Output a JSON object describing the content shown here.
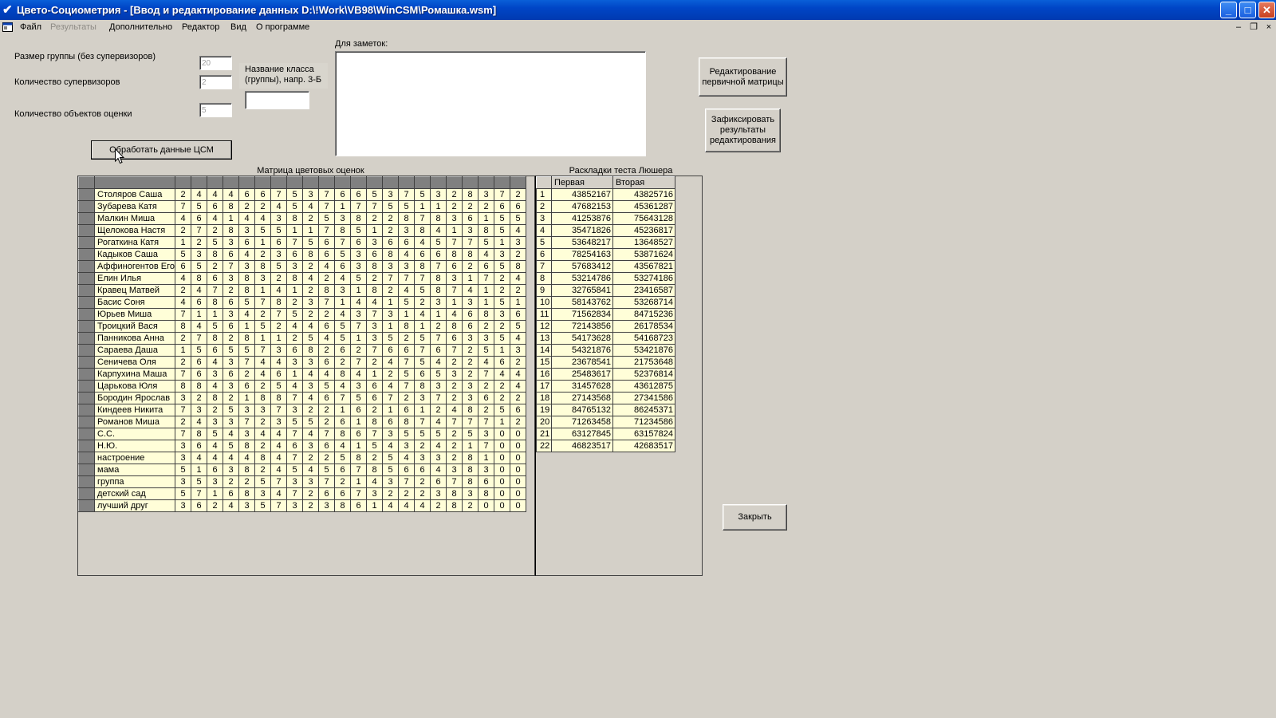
{
  "window": {
    "title": "Цвето-Социометрия - [Ввод  и редактирование данных D:\\!Work\\VB98\\WinCSM\\Ромашка.wsm]",
    "minimize": "_",
    "maximize": "□",
    "close": "✕"
  },
  "menu": {
    "items": [
      "Файл",
      "Результаты",
      "Дополнительно",
      "Редактор",
      "Вид",
      "О программе"
    ],
    "disabled_index": 1,
    "mdi_controls": [
      "–",
      "❐",
      "×"
    ]
  },
  "form": {
    "group_size_label": "Размер группы (без супервизоров)",
    "group_size_value": "20",
    "supervisors_label": "Количество супервизоров",
    "supervisors_value": "2",
    "objects_label": "Количество объектов оценки",
    "objects_value": "5",
    "class_name_label": "Название класса (группы), напр. 3-Б",
    "class_name_value": "",
    "notes_label": "Для заметок:",
    "notes_value": "",
    "process_button": "Обработать данные ЦСМ",
    "edit_matrix_button": "Редактирование первичной матрицы",
    "fix_results_button": "Зафиксировать результаты редактирования",
    "close_button": "Закрыть"
  },
  "matrix": {
    "caption": "Матрица цветовых оценок",
    "rows": [
      {
        "name": "Столяров Саша",
        "values": [
          2,
          4,
          4,
          4,
          6,
          6,
          7,
          5,
          3,
          7,
          6,
          6,
          5,
          3,
          7,
          5,
          3,
          2,
          8,
          3,
          7,
          2
        ]
      },
      {
        "name": "Зубарева Катя",
        "values": [
          7,
          5,
          6,
          8,
          2,
          2,
          4,
          5,
          4,
          7,
          1,
          7,
          7,
          5,
          5,
          1,
          1,
          2,
          2,
          2,
          6,
          6
        ]
      },
      {
        "name": "Малкин Миша",
        "values": [
          4,
          6,
          4,
          1,
          4,
          4,
          3,
          8,
          2,
          5,
          3,
          8,
          2,
          2,
          8,
          7,
          8,
          3,
          6,
          1,
          5,
          5
        ]
      },
      {
        "name": "Щелокова Настя",
        "values": [
          2,
          7,
          2,
          8,
          3,
          5,
          5,
          1,
          1,
          7,
          8,
          5,
          1,
          2,
          3,
          8,
          4,
          1,
          3,
          8,
          5,
          4
        ]
      },
      {
        "name": "Рогаткина Катя",
        "values": [
          1,
          2,
          5,
          3,
          6,
          1,
          6,
          7,
          5,
          6,
          7,
          6,
          3,
          6,
          6,
          4,
          5,
          7,
          7,
          5,
          1,
          3
        ]
      },
      {
        "name": "Кадыков Саша",
        "values": [
          5,
          3,
          8,
          6,
          4,
          2,
          3,
          6,
          8,
          6,
          5,
          3,
          6,
          8,
          4,
          6,
          6,
          8,
          8,
          4,
          3,
          2
        ]
      },
      {
        "name": "Аффиногентов Его",
        "values": [
          6,
          5,
          2,
          7,
          3,
          8,
          5,
          3,
          2,
          4,
          6,
          3,
          8,
          3,
          3,
          8,
          7,
          6,
          2,
          6,
          5,
          8
        ]
      },
      {
        "name": "Елин Илья",
        "values": [
          4,
          8,
          6,
          3,
          8,
          3,
          2,
          8,
          4,
          2,
          4,
          5,
          2,
          7,
          7,
          7,
          8,
          3,
          1,
          7,
          2,
          4
        ]
      },
      {
        "name": "Кравец Матвей",
        "values": [
          2,
          4,
          7,
          2,
          8,
          1,
          4,
          1,
          2,
          8,
          3,
          1,
          8,
          2,
          4,
          5,
          8,
          7,
          4,
          1,
          2,
          2
        ]
      },
      {
        "name": "Басис Соня",
        "values": [
          4,
          6,
          8,
          6,
          5,
          7,
          8,
          2,
          3,
          7,
          1,
          4,
          4,
          1,
          5,
          2,
          3,
          1,
          3,
          1,
          5,
          1
        ]
      },
      {
        "name": "Юрьев Миша",
        "values": [
          7,
          1,
          1,
          3,
          4,
          2,
          7,
          5,
          2,
          2,
          4,
          3,
          7,
          3,
          1,
          4,
          1,
          4,
          6,
          8,
          3,
          6
        ]
      },
      {
        "name": "Троицкий Вася",
        "values": [
          8,
          4,
          5,
          6,
          1,
          5,
          2,
          4,
          4,
          6,
          5,
          7,
          3,
          1,
          8,
          1,
          2,
          8,
          6,
          2,
          2,
          5
        ]
      },
      {
        "name": "Панникова Анна",
        "values": [
          2,
          7,
          8,
          2,
          8,
          1,
          1,
          2,
          5,
          4,
          5,
          1,
          3,
          5,
          2,
          5,
          7,
          6,
          3,
          3,
          5,
          4
        ]
      },
      {
        "name": "Сараева Даша",
        "values": [
          1,
          5,
          6,
          5,
          5,
          7,
          3,
          6,
          8,
          2,
          6,
          2,
          7,
          6,
          6,
          7,
          6,
          7,
          2,
          5,
          1,
          3
        ]
      },
      {
        "name": "Сеничева Оля",
        "values": [
          2,
          6,
          4,
          3,
          7,
          4,
          4,
          3,
          3,
          6,
          2,
          7,
          2,
          4,
          7,
          5,
          4,
          2,
          2,
          4,
          6,
          2
        ]
      },
      {
        "name": "Карпухина Маша",
        "values": [
          7,
          6,
          3,
          6,
          2,
          4,
          6,
          1,
          4,
          4,
          8,
          4,
          1,
          2,
          5,
          6,
          5,
          3,
          2,
          7,
          4,
          4
        ]
      },
      {
        "name": "Царькова Юля",
        "values": [
          8,
          8,
          4,
          3,
          6,
          2,
          5,
          4,
          3,
          5,
          4,
          3,
          6,
          4,
          7,
          8,
          3,
          2,
          3,
          2,
          2,
          4
        ]
      },
      {
        "name": "Бородин Ярослав",
        "values": [
          3,
          2,
          8,
          2,
          1,
          8,
          8,
          7,
          4,
          6,
          7,
          5,
          6,
          7,
          2,
          3,
          7,
          2,
          3,
          6,
          2,
          2
        ]
      },
      {
        "name": "Киндеев Никита",
        "values": [
          7,
          3,
          2,
          5,
          3,
          3,
          7,
          3,
          2,
          2,
          1,
          6,
          2,
          1,
          6,
          1,
          2,
          4,
          8,
          2,
          5,
          6
        ]
      },
      {
        "name": "Романов Миша",
        "values": [
          2,
          4,
          3,
          3,
          7,
          2,
          3,
          5,
          5,
          2,
          6,
          1,
          8,
          6,
          8,
          7,
          4,
          7,
          7,
          7,
          1,
          2
        ]
      },
      {
        "name": "С.С.",
        "values": [
          7,
          8,
          5,
          4,
          3,
          4,
          4,
          7,
          4,
          7,
          8,
          6,
          7,
          3,
          5,
          5,
          5,
          2,
          5,
          3,
          0,
          0
        ]
      },
      {
        "name": "Н.Ю.",
        "values": [
          3,
          6,
          4,
          5,
          8,
          2,
          4,
          6,
          3,
          6,
          4,
          1,
          5,
          4,
          3,
          2,
          4,
          2,
          1,
          7,
          0,
          0
        ]
      },
      {
        "name": "настроение",
        "values": [
          3,
          4,
          4,
          4,
          4,
          8,
          4,
          7,
          2,
          2,
          5,
          8,
          2,
          5,
          4,
          3,
          3,
          2,
          8,
          1,
          0,
          0
        ]
      },
      {
        "name": "мама",
        "values": [
          5,
          1,
          6,
          3,
          8,
          2,
          4,
          5,
          4,
          5,
          6,
          7,
          8,
          5,
          6,
          6,
          4,
          3,
          8,
          3,
          0,
          0
        ]
      },
      {
        "name": "группа",
        "values": [
          3,
          5,
          3,
          2,
          2,
          5,
          7,
          3,
          3,
          7,
          2,
          1,
          4,
          3,
          7,
          2,
          6,
          7,
          8,
          6,
          0,
          0
        ]
      },
      {
        "name": "детский сад",
        "values": [
          5,
          7,
          1,
          6,
          8,
          3,
          4,
          7,
          2,
          6,
          6,
          7,
          3,
          2,
          2,
          2,
          3,
          8,
          3,
          8,
          0,
          0
        ]
      },
      {
        "name": "лучший друг",
        "values": [
          3,
          6,
          2,
          4,
          3,
          5,
          7,
          3,
          2,
          3,
          8,
          6,
          1,
          4,
          4,
          4,
          2,
          8,
          2,
          0,
          0,
          0
        ]
      }
    ]
  },
  "luscher": {
    "caption": "Раскладки теста Люшера",
    "col_first": "Первая",
    "col_second": "Вторая",
    "rows": [
      [
        "1",
        "43852167",
        "43825716"
      ],
      [
        "2",
        "47682153",
        "45361287"
      ],
      [
        "3",
        "41253876",
        "75643128"
      ],
      [
        "4",
        "35471826",
        "45236817"
      ],
      [
        "5",
        "53648217",
        "13648527"
      ],
      [
        "6",
        "78254163",
        "53871624"
      ],
      [
        "7",
        "57683412",
        "43567821"
      ],
      [
        "8",
        "53214786",
        "53274186"
      ],
      [
        "9",
        "32765841",
        "23416587"
      ],
      [
        "10",
        "58143762",
        "53268714"
      ],
      [
        "11",
        "71562834",
        "84715236"
      ],
      [
        "12",
        "72143856",
        "26178534"
      ],
      [
        "13",
        "54173628",
        "54168723"
      ],
      [
        "14",
        "54321876",
        "53421876"
      ],
      [
        "15",
        "23678541",
        "21753648"
      ],
      [
        "16",
        "25483617",
        "52376814"
      ],
      [
        "17",
        "31457628",
        "43612875"
      ],
      [
        "18",
        "27143568",
        "27341586"
      ],
      [
        "19",
        "84765132",
        "86245371"
      ],
      [
        "20",
        "71263458",
        "71234586"
      ],
      [
        "21",
        "63127845",
        "63157824"
      ],
      [
        "22",
        "46823517",
        "42683517"
      ]
    ]
  }
}
